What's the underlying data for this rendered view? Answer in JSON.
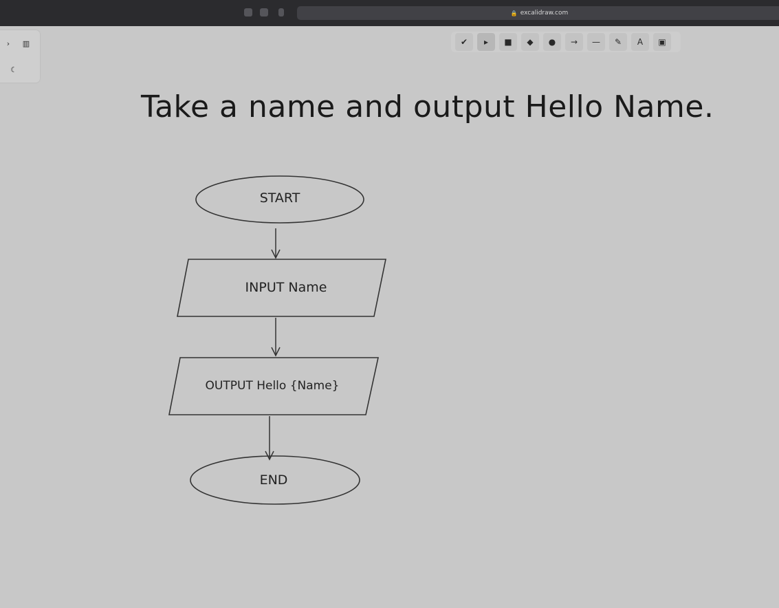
{
  "browser": {
    "url": "excalidraw.com",
    "icons": [
      "sidebar-toggle-icon",
      "back-arrow-icon",
      "lock-icon"
    ]
  },
  "side_panel": {
    "icons": [
      "library-icon",
      "moon-icon"
    ]
  },
  "toolbar": {
    "tools": [
      {
        "name": "lock-tool",
        "glyph": "✔",
        "active": false
      },
      {
        "name": "selection-tool",
        "glyph": "▸",
        "active": true
      },
      {
        "name": "rectangle-tool",
        "glyph": "■",
        "active": false
      },
      {
        "name": "diamond-tool",
        "glyph": "◆",
        "active": false
      },
      {
        "name": "ellipse-tool",
        "glyph": "●",
        "active": false
      },
      {
        "name": "arrow-tool",
        "glyph": "→",
        "active": false
      },
      {
        "name": "line-tool",
        "glyph": "—",
        "active": false
      },
      {
        "name": "draw-tool",
        "glyph": "✎",
        "active": false
      },
      {
        "name": "text-tool",
        "glyph": "A",
        "active": false
      },
      {
        "name": "image-tool",
        "glyph": "▣",
        "active": false
      }
    ]
  },
  "canvas": {
    "title": "Take a name and output Hello Name.",
    "flowchart": {
      "start": "START",
      "input": "INPUT Name",
      "output": "OUTPUT Hello {Name}",
      "end": "END"
    }
  },
  "colors": {
    "canvas_bg": "#c8c8c8",
    "stroke": "#3a3a3a",
    "chrome": "#2b2b2e"
  }
}
